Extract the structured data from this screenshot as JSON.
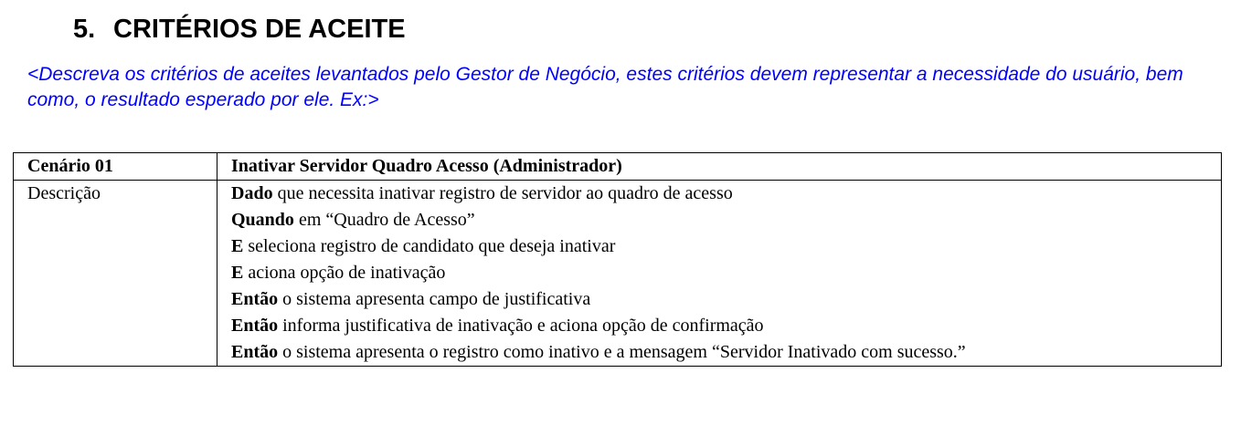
{
  "section": {
    "number": "5.",
    "title": "CRITÉRIOS DE ACEITE"
  },
  "instruction": "<Descreva os critérios de aceites levantados pelo Gestor de Negócio, estes critérios devem representar a necessidade do usuário, bem como, o resultado esperado por ele. Ex:>",
  "scenario_table": {
    "header": {
      "col1": "Cenário 01",
      "col2": "Inativar Servidor Quadro Acesso (Administrador)"
    },
    "row": {
      "label": "Descrição",
      "steps": [
        {
          "keyword": "Dado",
          "text": " que necessita inativar registro de servidor ao quadro de acesso"
        },
        {
          "keyword": "Quando",
          "text": " em “Quadro de Acesso”"
        },
        {
          "keyword": "E",
          "text": " seleciona registro de candidato que deseja inativar"
        },
        {
          "keyword": "E",
          "text": " aciona opção de inativação"
        },
        {
          "keyword": "Então",
          "text": " o sistema apresenta campo de justificativa"
        },
        {
          "keyword": "Então",
          "text": " informa justificativa de inativação e aciona opção de confirmação"
        },
        {
          "keyword": "Então",
          "text": " o sistema apresenta o registro como inativo e a mensagem “Servidor Inativado com sucesso.”"
        }
      ]
    }
  },
  "colors": {
    "instruction_text": "#0000ff",
    "body_text": "#000000"
  }
}
